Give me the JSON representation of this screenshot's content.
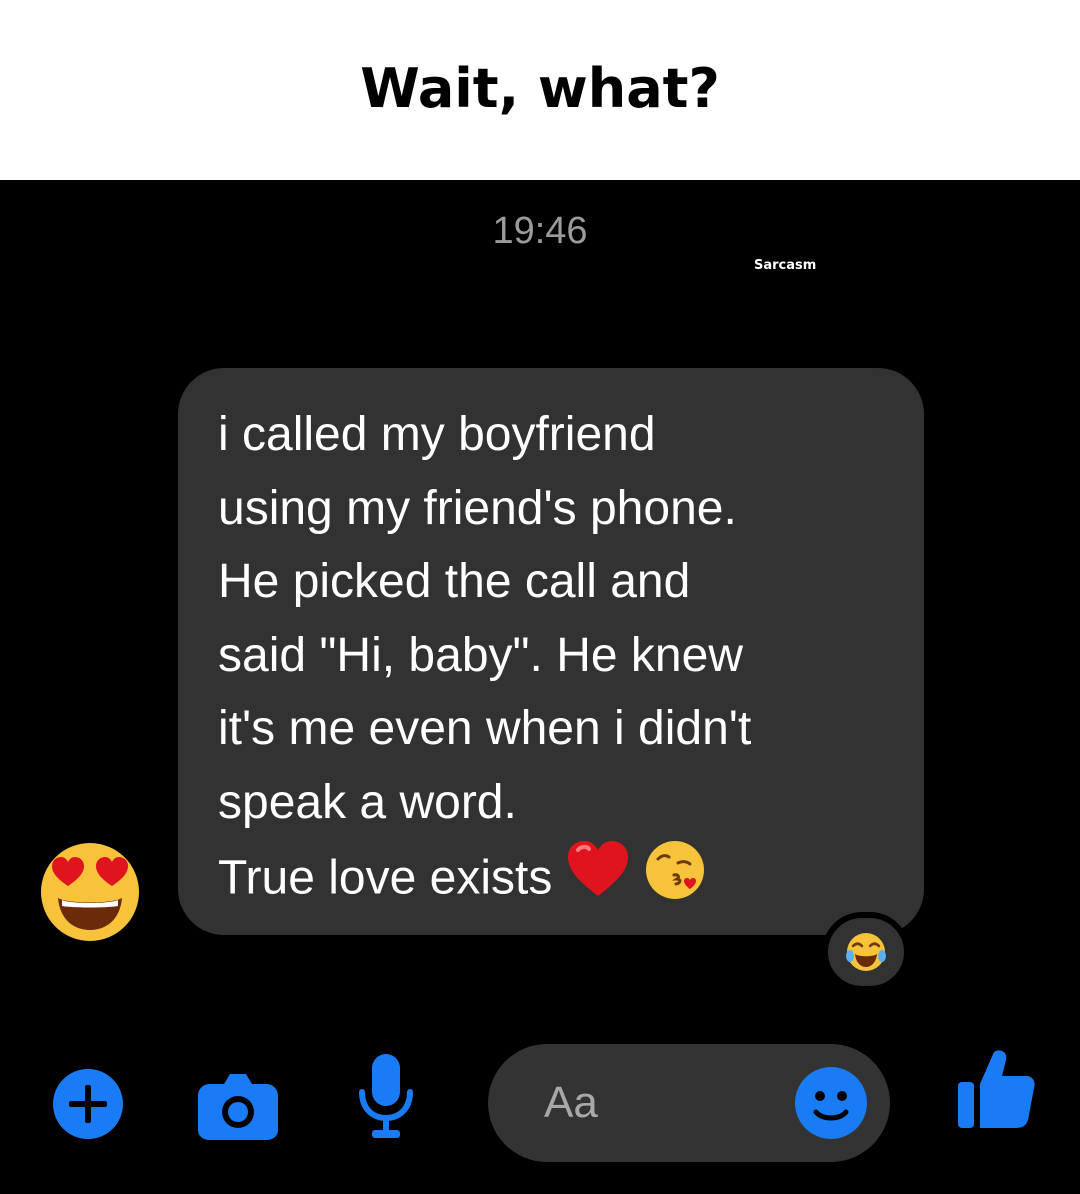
{
  "caption": {
    "title": "Wait, what?"
  },
  "conversation": {
    "timestamp": "19:46",
    "watermark": "Sarcasm",
    "message": {
      "lines": [
        "i called my boyfriend",
        "using my friend's phone.",
        "He picked the call and",
        "said \"Hi, baby\". He knew",
        "it's me even when i didn't",
        "speak a word.",
        "True love exists"
      ],
      "inline_emoji": [
        "red-heart",
        "face-blowing-kiss"
      ],
      "sender_reaction": "smiling-face-with-heart-eyes",
      "reaction": "face-with-tears-of-joy"
    }
  },
  "composer": {
    "placeholder": "Aa",
    "icons": [
      "plus-icon",
      "camera-icon",
      "microphone-icon",
      "smiley-icon",
      "thumbs-up-icon"
    ],
    "accent_color": "#1a7cf5"
  },
  "colors": {
    "background": "#000000",
    "bubble": "#323232",
    "text": "#ffffff",
    "timestamp": "#9b9b9b"
  }
}
